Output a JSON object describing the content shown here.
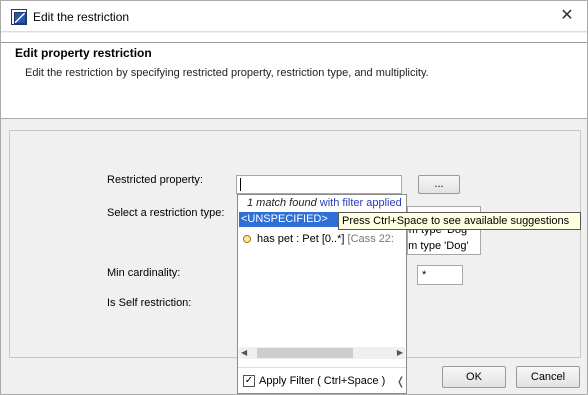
{
  "window": {
    "title": "Edit the restriction",
    "close_glyph": "✕"
  },
  "header": {
    "title": "Edit property restriction",
    "description": "Edit the restriction by specifying restricted property, restriction type, and multiplicity."
  },
  "form": {
    "restricted_property_label": "Restricted property:",
    "restricted_property_value": "",
    "browse_button": "...",
    "restriction_type_label": "Select a restriction type:",
    "min_cardinality_label": "Min cardinality:",
    "min_cardinality_value": "*",
    "self_restriction_label": "Is Self restriction:"
  },
  "popup": {
    "status_prefix": "1 match found",
    "status_suffix": "with filter applied",
    "selected_item": "<UNSPECIFIED>",
    "items": [
      {
        "label": "has pet : Pet [0..*]",
        "meta": "[Cass 22:"
      }
    ],
    "apply_filter_label": "Apply Filter ( Ctrl+Space )",
    "apply_filter_checked": true,
    "checkmark": "✓",
    "edge_glyph": "❬"
  },
  "behind": {
    "line1": "rom type 'Dog'",
    "line2": "om type 'Dog'"
  },
  "tooltip": "Press Ctrl+Space to see available suggestions",
  "buttons": {
    "ok": "OK",
    "cancel": "Cancel"
  },
  "icons": {
    "app": "magicdraw-icon",
    "close": "close-icon",
    "property": "property-icon"
  }
}
